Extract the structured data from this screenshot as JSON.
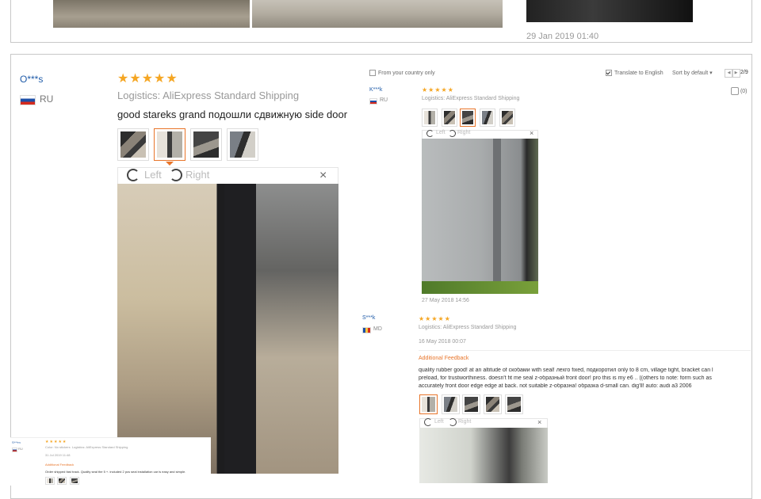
{
  "prev_review": {
    "date": "29 Jan 2019 01:40"
  },
  "review1": {
    "name": "O***s",
    "country": "RU",
    "stars": "★★★★★",
    "logistics_label": "Logistics:",
    "logistics_value": "AliExpress Standard Shipping",
    "text": "good stareks grand подошли сдвижную side door",
    "viewer": {
      "left_label": "Left",
      "right_label": "Right",
      "close": "×"
    }
  },
  "filters": {
    "from_country": "From your country only",
    "translate": "Translate to English",
    "sort": "Sort by default",
    "sort_caret": "▾",
    "page_prev": "◀",
    "page_next": "▶",
    "page": "2/9"
  },
  "review2": {
    "name": "K***k",
    "country": "RU",
    "stars": "★★★★★",
    "logistics_label": "Logistics:",
    "logistics_value": "AliExpress Standard Shipping",
    "helpful_count": "(0)",
    "viewer": {
      "left_label": "Left",
      "right_label": "Right",
      "close": "×"
    },
    "date": "27 May 2018 14:56"
  },
  "review3": {
    "name": "S***k",
    "country": "MD",
    "stars": "★★★★★",
    "logistics_label": "Logistics:",
    "logistics_value": "AliExpress Standard Shipping",
    "date": "16 May 2018 00:07",
    "additional_label": "Additional Feedback",
    "text_line1": "quality rubber good! at an altitude of скобами with seal! лехго fixed, подкоротил only to 8 cm, village tight, bracket can l",
    "text_line2": "preload, for trustworthiness. doesn't fit me seal z-образный front door! pro this is my e6 .. ((others to note: form such as",
    "text_line3": "accurately front door edge edge at back. not suitable z-образна! образка d-small can. dig'll! auto: audi a3 2006",
    "viewer": {
      "left_label": "Left",
      "right_label": "Right",
      "close": "×"
    }
  },
  "mini": {
    "name": "S***m",
    "country": "RU",
    "stars": "★★★★★",
    "color_label": "Color:",
    "color_value": "No stickers",
    "logistics_label": "Logistics:",
    "logistics_value": "AliExpress Standard Shipping",
    "date": "31 Jul 2019 11:48",
    "additional_label": "Additional Feedback",
    "text": "Order shipped fast track. Quality seal the 5 +. included 2 pcs seal installation car is easy and simple."
  },
  "helpful_icon": "thumbs-up-icon"
}
